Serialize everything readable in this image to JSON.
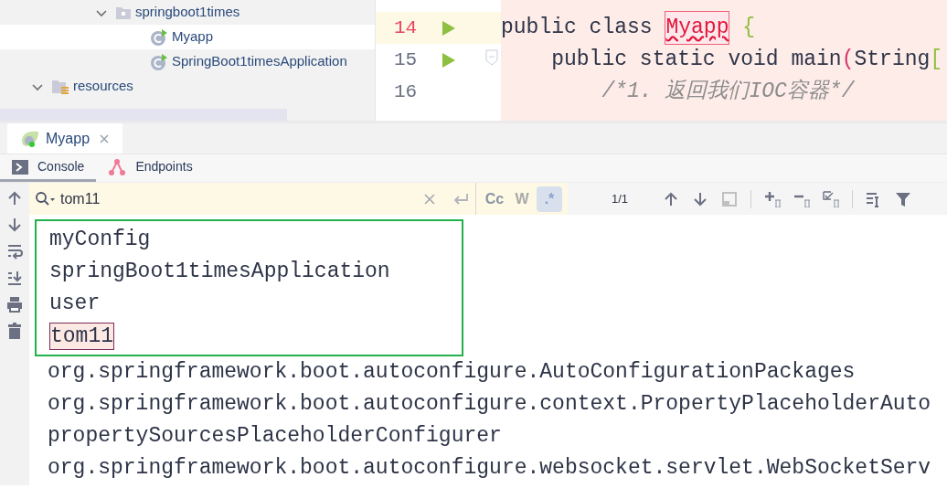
{
  "project_tree": [
    {
      "label": "springboot1times",
      "kind": "package",
      "expanded": true,
      "selected": false,
      "children": [
        {
          "label": "Myapp",
          "kind": "class",
          "selected": true
        },
        {
          "label": "SpringBoot1timesApplication",
          "kind": "class",
          "selected": false
        }
      ]
    },
    {
      "label": "resources",
      "kind": "resources",
      "expanded": true,
      "selected": false
    }
  ],
  "editor": {
    "lines": [
      {
        "number": "14",
        "current": true,
        "run": true,
        "fold": false,
        "segments": [
          {
            "kind": "keyword",
            "text": "public class "
          },
          {
            "kind": "error",
            "text": "Myapp"
          },
          {
            "kind": "brace",
            "text": " {"
          }
        ]
      },
      {
        "number": "15",
        "current": false,
        "run": true,
        "fold": true,
        "segments": [
          {
            "kind": "keyword",
            "text": "    public static void "
          },
          {
            "kind": "plain",
            "text": "main"
          },
          {
            "kind": "paren",
            "text": "("
          },
          {
            "kind": "plain",
            "text": "String"
          },
          {
            "kind": "brace",
            "text": "["
          }
        ]
      },
      {
        "number": "16",
        "current": false,
        "run": false,
        "fold": false,
        "segments": [
          {
            "kind": "comment",
            "text": "        /*1. 返回我们IOC容器*/"
          }
        ]
      }
    ]
  },
  "run_tabs": [
    {
      "label": "Myapp",
      "selected": true
    }
  ],
  "tool_tabs": [
    {
      "label": "Console",
      "kind": "console",
      "selected": true
    },
    {
      "label": "Endpoints",
      "kind": "endpoints",
      "selected": false
    }
  ],
  "search": {
    "value": "tom11",
    "match_count": "1/1",
    "options": [
      {
        "label": "Cc",
        "on": false,
        "disabled": false
      },
      {
        "label": "W",
        "on": false,
        "disabled": true
      },
      {
        "label": ".*",
        "on": true,
        "disabled": false
      }
    ]
  },
  "console": {
    "boxed_lines": [
      {
        "text": "myConfig",
        "match": false
      },
      {
        "text": "springBoot1timesApplication",
        "match": false
      },
      {
        "text": "user",
        "match": false
      },
      {
        "text": "tom11",
        "match": true
      }
    ],
    "lines": [
      {
        "text": "org.springframework.boot.autoconfigure.AutoConfigurationPackages",
        "match": false
      },
      {
        "text": "org.springframework.boot.autoconfigure.context.PropertyPlaceholderAuto",
        "match": false
      },
      {
        "text": "propertySourcesPlaceholderConfigurer",
        "match": false
      },
      {
        "text": "org.springframework.boot.autoconfigure.websocket.servlet.WebSocketServ",
        "match": false
      }
    ]
  }
}
